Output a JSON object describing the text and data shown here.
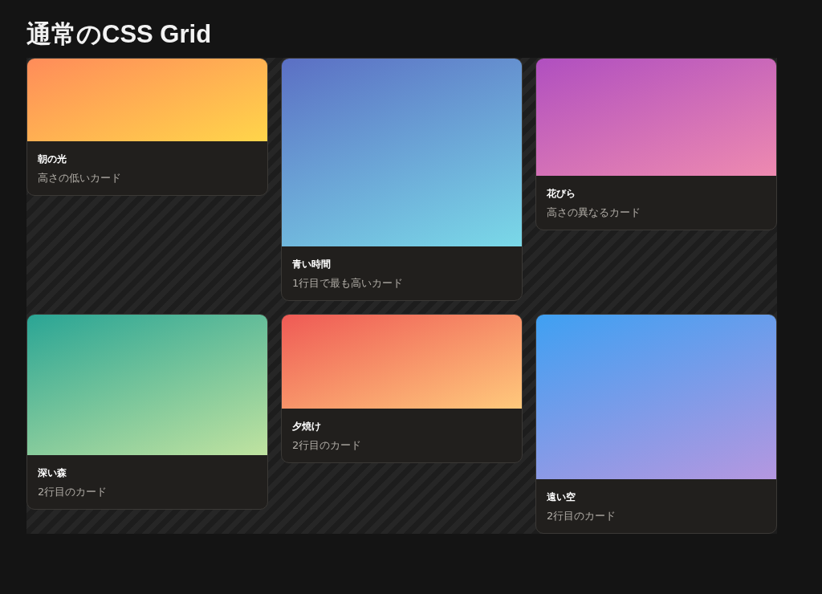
{
  "title": "通常のCSS Grid",
  "cards": [
    {
      "title": "朝の光",
      "subtitle": "高さの低いカード",
      "color": "#ff8c5a"
    },
    {
      "title": "青い時間",
      "subtitle": "1行目で最も高いカード",
      "color": "#5b6fc4"
    },
    {
      "title": "花びら",
      "subtitle": "高さの異なるカード",
      "color": "#b04fc0"
    },
    {
      "title": "深い森",
      "subtitle": "2行目のカード",
      "color": "#2aa595"
    },
    {
      "title": "夕焼け",
      "subtitle": "2行目のカード",
      "color": "#ef5a55"
    },
    {
      "title": "遠い空",
      "subtitle": "2行目のカード",
      "color": "#3fa0f2"
    }
  ]
}
